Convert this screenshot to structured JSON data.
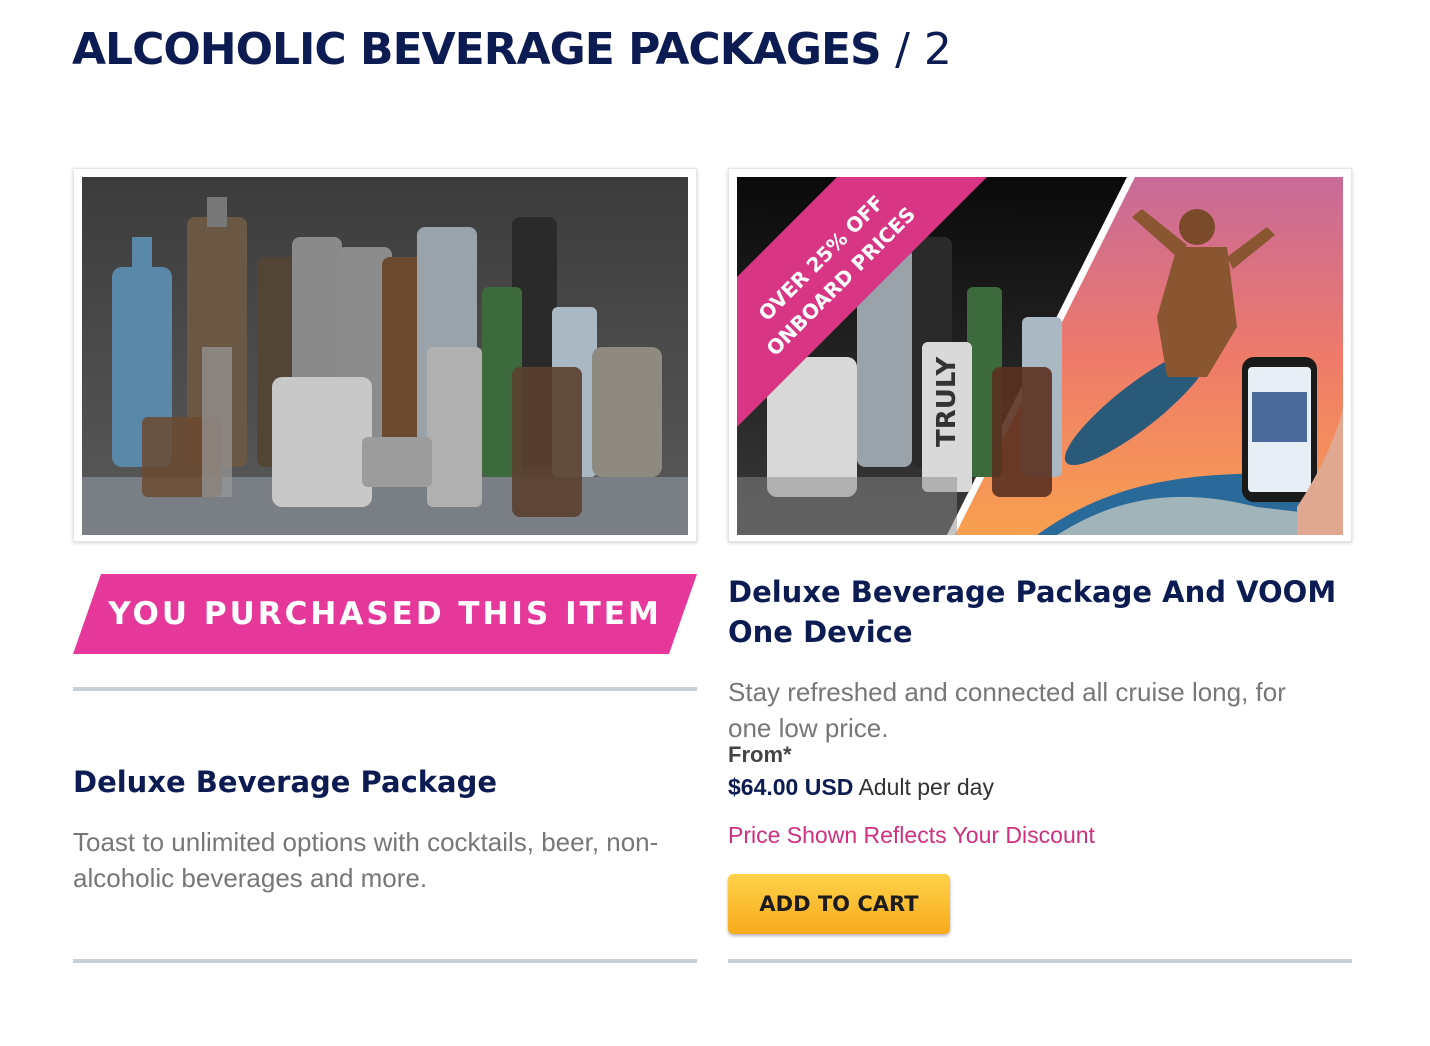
{
  "header": {
    "title": "ALCOHOLIC BEVERAGE PACKAGES",
    "count": "/ 2"
  },
  "products": [
    {
      "title": "Deluxe Beverage Package",
      "description": "Toast to unlimited options with cocktails, beer, non-alcoholic beverages and more.",
      "status_banner": "YOU PURCHASED THIS ITEM",
      "image_icon": "beverage-bottles-photo"
    },
    {
      "title": "Deluxe Beverage Package And VOOM One Device",
      "description": "Stay refreshed and connected all cruise long, for one low price.",
      "promo_line1": "OVER 25% OFF",
      "promo_line2": "ONBOARD PRICES",
      "can_label": "TRULY",
      "price_prefix": "From*",
      "price": "$64.00 USD",
      "price_unit": "Adult per day",
      "discount_note": "Price Shown Reflects Your Discount",
      "add_to_cart": "ADD TO CART",
      "image_icon": "beverage-and-surfer-photo"
    }
  ],
  "colors": {
    "navy": "#0c1c52",
    "pink": "#e5389a",
    "discount_text": "#cf2f7f",
    "button": "#f8aa1c",
    "divider": "#c9d0d5"
  }
}
